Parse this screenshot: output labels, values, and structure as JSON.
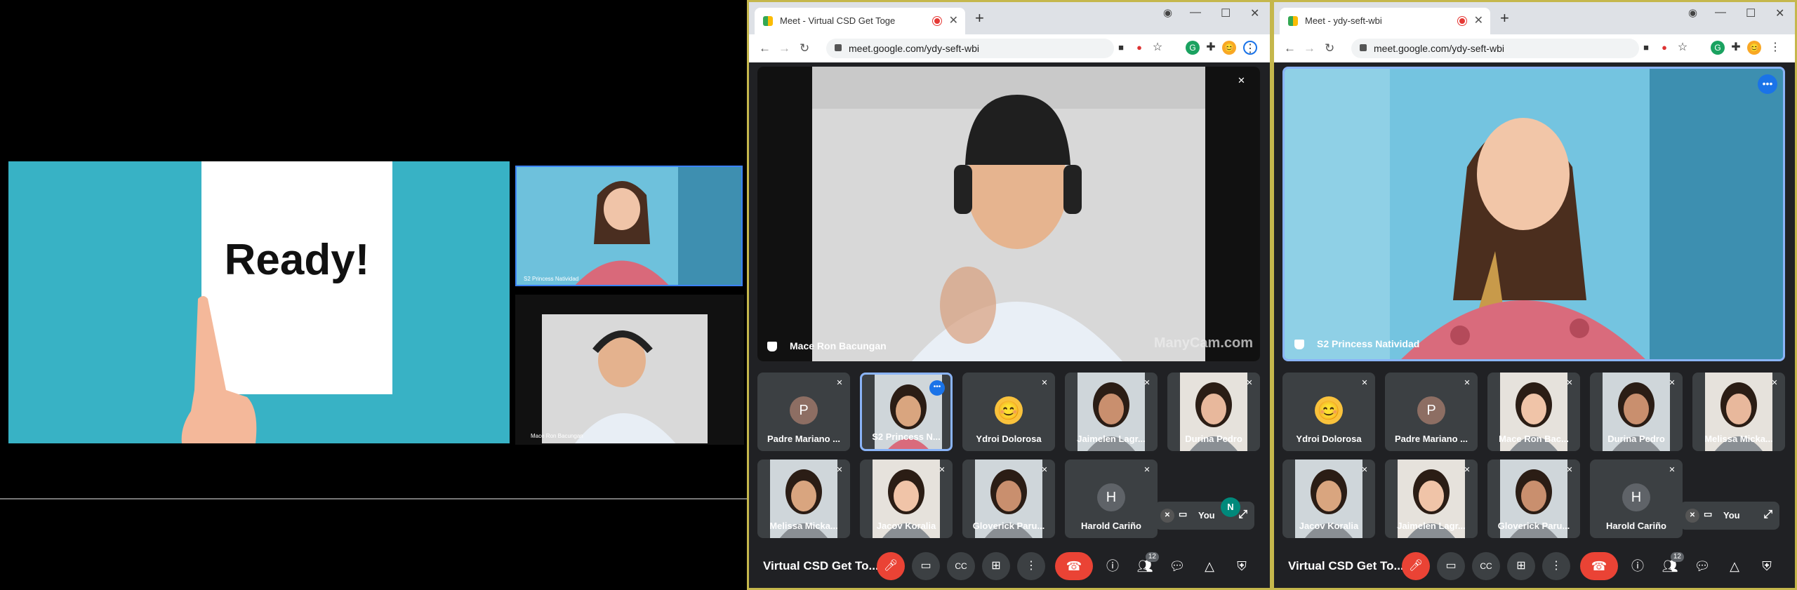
{
  "slide": {
    "text": "Ready!"
  },
  "left_panel": {
    "thumb1_label": "S2 Princess Natividad",
    "thumb2_label": "Mace Ron Bacungan"
  },
  "win1": {
    "tab_title": "Meet - Virtual CSD Get Toge",
    "url": "meet.google.com/ydy-seft-wbi",
    "main_speaker": "Mace Ron Bacungan",
    "watermark": "ManyCam.com",
    "tiles": [
      {
        "name": "Padre Mariano ...",
        "type": "avatar",
        "initial": "P",
        "color": "#8d6e63"
      },
      {
        "name": "S2 Princess N...",
        "type": "photo",
        "selected": true
      },
      {
        "name": "Ydroi Dolorosa",
        "type": "emoji",
        "emoji": "😊"
      },
      {
        "name": "Jaimelen Lagr...",
        "type": "photo"
      },
      {
        "name": "Durina Pedro",
        "type": "photo"
      },
      {
        "name": "Melissa Micka...",
        "type": "photo"
      },
      {
        "name": "Jacov Koralia",
        "type": "photo"
      },
      {
        "name": "Gloverick Paru...",
        "type": "photo"
      },
      {
        "name": "Harold Cariño",
        "type": "avatar",
        "initial": "H",
        "color": "#5f6368"
      }
    ],
    "you_initial": "N",
    "you_label": "You",
    "meeting_title": "Virtual CSD Get To...",
    "participants_count": "12"
  },
  "win2": {
    "tab_title": "Meet - ydy-seft-wbi",
    "url": "meet.google.com/ydy-seft-wbi",
    "main_speaker": "S2 Princess Natividad",
    "tiles": [
      {
        "name": "Ydroi Dolorosa",
        "type": "emoji",
        "emoji": "😊"
      },
      {
        "name": "Padre Mariano ...",
        "type": "avatar",
        "initial": "P",
        "color": "#8d6e63"
      },
      {
        "name": "Mace Ron Bac...",
        "type": "photo"
      },
      {
        "name": "Durina Pedro",
        "type": "photo"
      },
      {
        "name": "Melissa Micka...",
        "type": "photo"
      },
      {
        "name": "Jacov Koralia",
        "type": "photo"
      },
      {
        "name": "Jaimelen Lagr...",
        "type": "photo"
      },
      {
        "name": "Gloverick Paru...",
        "type": "photo"
      },
      {
        "name": "Harold Cariño",
        "type": "avatar",
        "initial": "H",
        "color": "#5f6368"
      }
    ],
    "you_label": "You",
    "meeting_title": "Virtual CSD Get To...",
    "participants_count": "12"
  },
  "colors": {
    "meet_bg": "#202124",
    "tile_bg": "#3c4043",
    "accent": "#1a73e8",
    "danger": "#ea4335",
    "slide": "#38b2c5"
  }
}
